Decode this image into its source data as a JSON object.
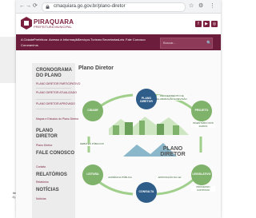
{
  "page": {
    "left_notes": [
      "ite",
      "4)."
    ]
  },
  "browser": {
    "url": "cmaquiara.go.gov.br/plano-diretor",
    "nav_back": "←",
    "nav_forward": "→",
    "nav_reload": "⟳",
    "toolbar_icons": [
      "☆",
      "⚙",
      "⋮"
    ]
  },
  "header": {
    "logo_name": "PIRAQUARA",
    "logo_sub": "PREFEITURA MUNICIPAL",
    "social": [
      "f",
      "▶",
      "◎"
    ]
  },
  "nav": {
    "items": [
      "A Cidade",
      "Prefeitura",
      "Acesso à Informação",
      "Serviços",
      "Turismo",
      "Secretarias",
      "Leis",
      "Fale Conosco",
      "Coronavírus"
    ],
    "search_placeholder": "Buscar...",
    "search_icon": "🔍"
  },
  "sidebar": {
    "sections": [
      {
        "title": "CRONOGRAMA DO PLANO"
      },
      {
        "title": "PLANO DIRETOR"
      },
      {
        "title": "FALE CONOSCO"
      },
      {
        "title": "RELATÓRIOS"
      },
      {
        "title": "NOTÍCIAS"
      }
    ],
    "links_cronograma": [
      "PLANO DIRETOR PARTICIPATIVO",
      "PLANO DIRETOR ATUALIZADO",
      "PLANO DIRETOR APROVADO",
      "Mapas e Estudos do Plano Diretor"
    ],
    "link_diretor": "Plano Diretor",
    "link_fale": "Contato",
    "link_relatorios": "Relatórios",
    "link_noticias": "Notícias"
  },
  "main": {
    "title": "Plano Diretor",
    "diagram": {
      "center_top": "PLANO",
      "center_bottom": "DIRETOR",
      "circles": [
        "CIDADE",
        "PLANO DIRETOR",
        "PROJETO",
        "LEITURA",
        "CONSULTA",
        "LEGISLATIVO"
      ],
      "labels": [
        "PROCEDIMENTO DE ELABORAÇÃO E REVISÃO",
        "INVENTÁRIO DOS DADOS",
        "DEBATES PÚBLICOS",
        "AUDIÊNCIA PÚBLICA",
        "APROVAÇÃO DA LEI",
        "PROCESSO CONTÍNUO"
      ]
    }
  },
  "colors": {
    "brand": "#6b1d3b",
    "accent": "#7fb26b"
  }
}
